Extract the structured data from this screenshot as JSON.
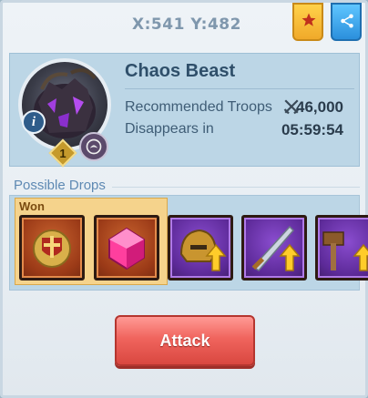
{
  "header": {
    "coordinates": "X:541 Y:482",
    "favorite_icon": "star-icon",
    "share_icon": "share-icon"
  },
  "monster": {
    "name": "Chaos Beast",
    "level": "1",
    "recommended_troops_label": "Recommended Troops",
    "recommended_troops_value": "46,000",
    "disappears_label": "Disappears in",
    "disappears_value": "05:59:54",
    "info_icon": "i"
  },
  "drops": {
    "title": "Possible Drops",
    "won_label": "Won",
    "items": [
      {
        "name": "golden-shield-emblem",
        "rarity": "orange",
        "won": true
      },
      {
        "name": "pink-gem",
        "rarity": "orange",
        "won": true
      },
      {
        "name": "helmet-upgrade",
        "rarity": "purple",
        "won": false
      },
      {
        "name": "sword-upgrade",
        "rarity": "purple",
        "won": false
      },
      {
        "name": "hammer-upgrade",
        "rarity": "purple",
        "won": false
      }
    ]
  },
  "actions": {
    "attack_label": "Attack"
  },
  "colors": {
    "accent_gold": "#f0a92a",
    "share_blue": "#2b8fdc",
    "attack_red": "#e8554e",
    "rarity_orange": "#9b3a17",
    "rarity_purple": "#5d2a99"
  }
}
